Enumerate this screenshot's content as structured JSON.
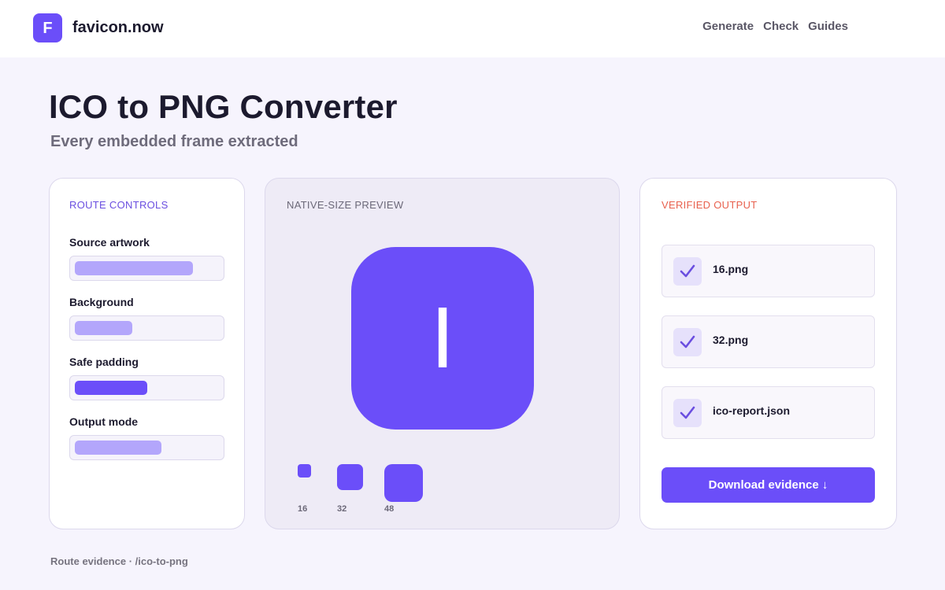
{
  "header": {
    "logo_letter": "F",
    "brand": "favicon.now",
    "nav": [
      "Generate",
      "Check",
      "Guides"
    ]
  },
  "page": {
    "title": "ICO to PNG Converter",
    "subtitle": "Every embedded frame extracted"
  },
  "controls": {
    "label": "ROUTE CONTROLS",
    "items": [
      {
        "label": "Source artwork",
        "fill": 0.82,
        "color": "#b3a6fb"
      },
      {
        "label": "Background",
        "fill": 0.4,
        "color": "#b3a6fb"
      },
      {
        "label": "Safe padding",
        "fill": 0.5,
        "color": "#6b4ef9"
      },
      {
        "label": "Output mode",
        "fill": 0.6,
        "color": "#b3a6fb"
      }
    ]
  },
  "preview": {
    "label": "NATIVE-SIZE PREVIEW",
    "icon_glyph": "I",
    "sizes": [
      "16",
      "32",
      "48"
    ]
  },
  "output": {
    "label": "VERIFIED OUTPUT",
    "files": [
      "16.png",
      "32.png",
      "ico-report.json"
    ],
    "download_label": "Download evidence ↓"
  },
  "footer": {
    "note": "Route evidence · /ico-to-png"
  },
  "colors": {
    "accent": "#6b4ef9",
    "accent_light": "#b3a6fb",
    "verified": "#e8614e"
  }
}
